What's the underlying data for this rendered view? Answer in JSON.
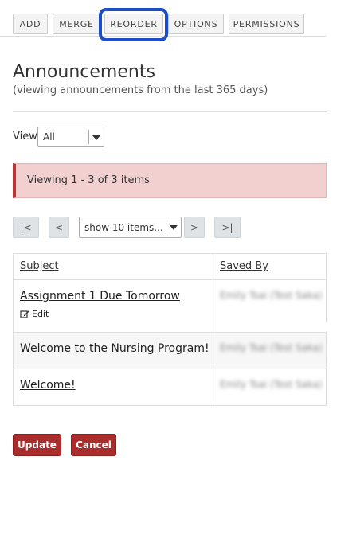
{
  "toolbar": {
    "items": [
      "ADD",
      "MERGE",
      "REORDER",
      "OPTIONS",
      "PERMISSIONS"
    ],
    "highlight_color": "#1c4ec7"
  },
  "page": {
    "title": "Announcements",
    "subtitle": "(viewing announcements from the last 365 days)"
  },
  "view": {
    "label": "View",
    "selected": "All"
  },
  "alert": {
    "text": "Viewing 1 - 3 of 3 items",
    "accent_color": "#b93535"
  },
  "pager": {
    "first": "|<",
    "prev": "<",
    "page_size": "show 10 items...",
    "next": ">",
    "last": ">|"
  },
  "table": {
    "headers": [
      "Subject",
      "Saved By"
    ],
    "rows": [
      {
        "subject": "Assignment 1 Due Tomorrow",
        "edit": "Edit",
        "saved_by": "Emily Tsai (Test Saka)"
      },
      {
        "subject": "Welcome to the Nursing Program!",
        "saved_by": "Emily Tsai (Test Saka)"
      },
      {
        "subject": "Welcome!",
        "saved_by": "Emily Tsai (Test Saka)"
      }
    ]
  },
  "actions": {
    "update": "Update",
    "cancel": "Cancel",
    "color": "#a92d2d"
  },
  "icons": {
    "edit": "pencil-square-icon",
    "dropdown": "caret-down-icon"
  }
}
